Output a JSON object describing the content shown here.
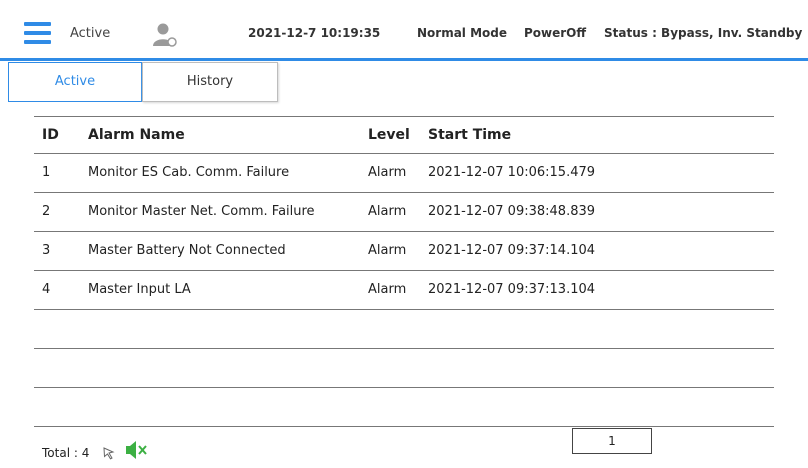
{
  "header": {
    "active_label": "Active",
    "datetime": "2021-12-7 10:19:35",
    "mode": "Normal Mode",
    "power": "PowerOff",
    "status": "Status : Bypass, Inv. Standby",
    "accent_color": "#2f8be6"
  },
  "tabs": [
    {
      "label": "Active",
      "selected": true
    },
    {
      "label": "History",
      "selected": false
    }
  ],
  "table": {
    "headers": {
      "id": "ID",
      "name": "Alarm Name",
      "level": "Level",
      "time": "Start Time"
    },
    "rows": [
      {
        "id": "1",
        "name": "Monitor ES Cab. Comm. Failure",
        "level": "Alarm",
        "time": "2021-12-07 10:06:15.479"
      },
      {
        "id": "2",
        "name": "Monitor Master Net. Comm. Failure",
        "level": "Alarm",
        "time": "2021-12-07 09:38:48.839"
      },
      {
        "id": "3",
        "name": "Master Battery Not Connected",
        "level": "Alarm",
        "time": "2021-12-07 09:37:14.104"
      },
      {
        "id": "4",
        "name": "Master Input LA",
        "level": "Alarm",
        "time": "2021-12-07 09:37:13.104"
      }
    ]
  },
  "footer": {
    "total": "Total : 4",
    "page": "1"
  },
  "icons": {
    "menu": "menu-icon",
    "user": "user-icon",
    "cursor": "cursor-icon",
    "mute": "mute-icon"
  }
}
